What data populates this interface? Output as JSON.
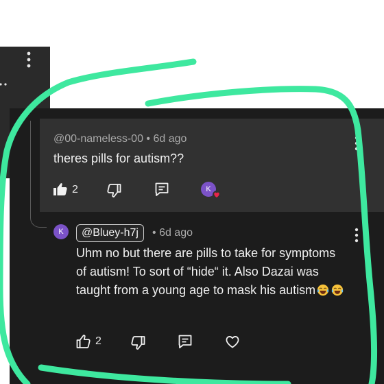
{
  "colors": {
    "card_bg": "#1c1c1c",
    "highlight_bg": "#313131",
    "text": "#f1f1f1",
    "meta": "#aaaaaa",
    "avatar": "#7b52c7",
    "scribble": "#3ee89f",
    "heart": "#e8254a"
  },
  "comment_one": {
    "author": "@00-nameless-00",
    "separator": "•",
    "time": "6d ago",
    "text": "theres pills for autism??",
    "likes": "2",
    "creator_avatar_letter": "K",
    "icons": [
      "thumbs-up-filled-icon",
      "thumbs-down-icon",
      "reply-icon",
      "creator-heart-avatar"
    ]
  },
  "comment_two": {
    "avatar_letter": "K",
    "author": "@Bluey-h7j",
    "separator": "•",
    "time": "6d ago",
    "text": "Uhm no but there are pills to take for symptoms of autism! To sort of “hide“ it. Also Dazai was taught from a young age to mask his autism",
    "emojis": [
      "😂",
      "😂"
    ],
    "likes": "2",
    "icons": [
      "thumbs-up-icon",
      "thumbs-down-icon",
      "reply-icon",
      "heart-icon"
    ]
  }
}
